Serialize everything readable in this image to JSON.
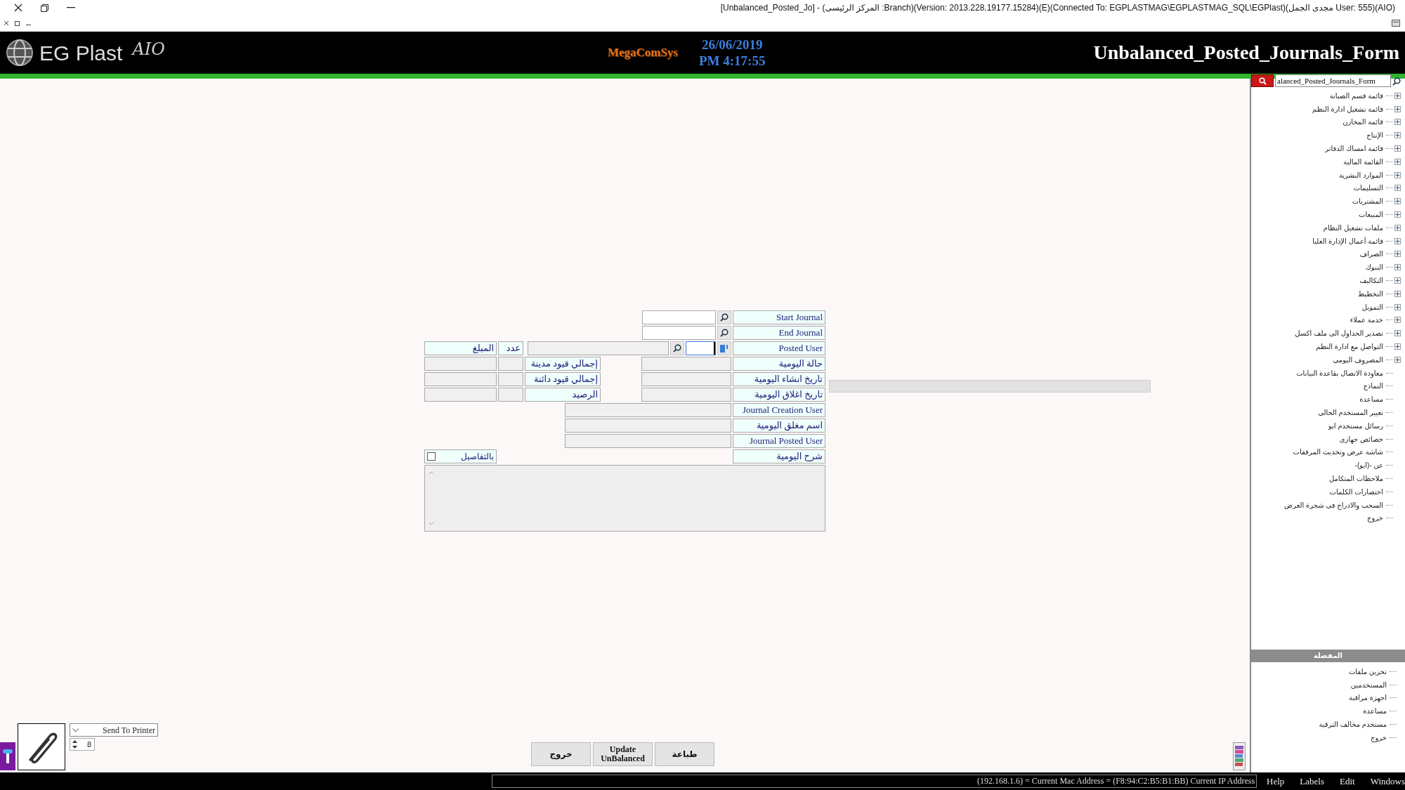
{
  "window": {
    "title": "[Unbalanced_Posted_Jo] - (المركز الرئيسى :Branch)(Version: 2013.228.19177.15284)(E)(Connected To: EGPLASTMAG\\EGPLASTMAG_SQL\\EGPlast)(مجدى الجمل User: 555)(AIO)"
  },
  "header": {
    "app_name": "EG Plast",
    "app_suffix": "AIO",
    "vendor_logo": "MegaComSys",
    "date": "26/06/2019",
    "time": "PM 4:17:55",
    "form_title": "Unbalanced_Posted_Journals_Form"
  },
  "form": {
    "criteria": [
      {
        "label": "Start Journal",
        "kind": "range",
        "focused": false
      },
      {
        "label": "End Journal",
        "kind": "range",
        "focused": false
      },
      {
        "label": "Posted User",
        "kind": "user",
        "focused": true
      }
    ],
    "totals_headers": [
      "عدد",
      "المبلغ"
    ],
    "info_rows": [
      {
        "label": "حالة اليومية",
        "total_label": "إجمالي قيود مدينة"
      },
      {
        "label": "تاريخ انشاء اليومية",
        "total_label": "إجمالي قيود دائنة"
      },
      {
        "label": "تاريخ اغلاق اليومية",
        "total_label": "الرصيد"
      }
    ],
    "user_rows": [
      {
        "label": "Journal Creation User"
      },
      {
        "label": "اسم مغلق اليومية"
      },
      {
        "label": "Journal Posted User"
      }
    ],
    "description": {
      "label": "شرح اليومية"
    },
    "details_checkbox": {
      "label": "بالتفاصيل",
      "checked": false
    }
  },
  "print": {
    "destination": "Send To Printer",
    "copies": "8"
  },
  "buttons": [
    "طباعة",
    "Update UnBalanced",
    "خروج"
  ],
  "sidebar": {
    "search": {
      "value": "alanced_Posted_Journals_Form"
    },
    "tree": [
      {
        "label": "قائمة قسم الصيانة",
        "kind": "folder",
        "expanded": false
      },
      {
        "label": "قائمة تشغيل ادارة النظم",
        "kind": "folder",
        "expanded": false
      },
      {
        "label": "قائمة المخازن",
        "kind": "folder",
        "expanded": false
      },
      {
        "label": "الإنتاج",
        "kind": "folder",
        "expanded": false
      },
      {
        "label": "قائمة امساك الدفاتر",
        "kind": "folder",
        "expanded": false
      },
      {
        "label": "القائمة المالية",
        "kind": "folder",
        "expanded": false
      },
      {
        "label": "الموارد البشرية",
        "kind": "folder",
        "expanded": false
      },
      {
        "label": "التسليمات",
        "kind": "folder",
        "expanded": false
      },
      {
        "label": "المشتريات",
        "kind": "folder",
        "expanded": false
      },
      {
        "label": "المبيعات",
        "kind": "folder",
        "expanded": false
      },
      {
        "label": "ملفات تشغيل النظام",
        "kind": "folder",
        "expanded": false
      },
      {
        "label": "قائمة أعمال الإدارة العليا",
        "kind": "folder",
        "expanded": false
      },
      {
        "label": "الصراف",
        "kind": "folder",
        "expanded": false
      },
      {
        "label": "البنوك",
        "kind": "folder",
        "expanded": false
      },
      {
        "label": "التكاليف",
        "kind": "folder",
        "expanded": false
      },
      {
        "label": "التخطيط",
        "kind": "folder",
        "expanded": false
      },
      {
        "label": "التمويل",
        "kind": "folder",
        "expanded": false
      },
      {
        "label": "خدمة عملاء",
        "kind": "folder",
        "expanded": false
      },
      {
        "label": "تصدير الجداول الى ملف اكسل",
        "kind": "folder",
        "expanded": false
      },
      {
        "label": "التواصل مع ادارة النظم",
        "kind": "folder",
        "expanded": false
      },
      {
        "label": "المصروف اليومى",
        "kind": "folder",
        "expanded": false
      },
      {
        "label": "معاودة الاتصال بقاعدة البيانات",
        "kind": "leaf"
      },
      {
        "label": "النماذج",
        "kind": "leaf"
      },
      {
        "label": "مساعدة",
        "kind": "leaf"
      },
      {
        "label": "تغيير المستخدم الحالى",
        "kind": "leaf"
      },
      {
        "label": "رسائل مستخدم ايو",
        "kind": "leaf"
      },
      {
        "label": "خصائص جهازى",
        "kind": "leaf"
      },
      {
        "label": "شاشة عرض وتحديث المرفقات",
        "kind": "leaf"
      },
      {
        "label": "عن -(ايو)-",
        "kind": "leaf"
      },
      {
        "label": "ملاحظات المتكامل",
        "kind": "leaf"
      },
      {
        "label": "اختصارات الكلمات",
        "kind": "leaf"
      },
      {
        "label": "السحب والادراج فى شجرة العرض",
        "kind": "leaf"
      },
      {
        "label": "خروج",
        "kind": "leaf"
      }
    ],
    "favorites_title": "المفضلة",
    "favorites": [
      "تخزين ملفات",
      "المستخدمين",
      "اجهزة مراقبة",
      "مساعدة",
      "مستخدم مخالف الترقية",
      "خروج"
    ]
  },
  "status_bar": {
    "text": "(192.168.1.6) = Current Mac Address = (F8:94:C2:B5:B1:BB) Current IP Address",
    "menus": [
      "Windows",
      "Edit",
      "Labels",
      "Help"
    ]
  }
}
